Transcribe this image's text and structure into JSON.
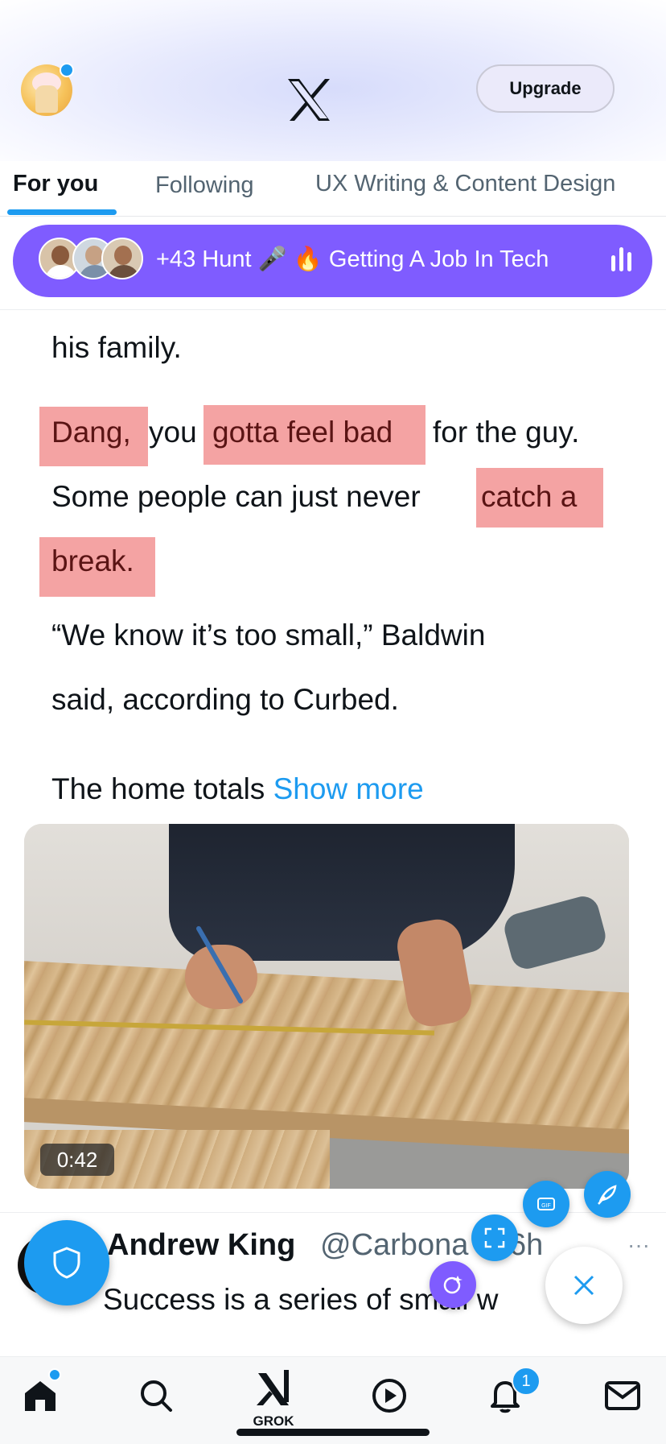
{
  "header": {
    "upgrade_label": "Upgrade"
  },
  "tabs": [
    {
      "label": "For you",
      "active": true
    },
    {
      "label": "Following",
      "active": false
    },
    {
      "label": "UX Writing & Content Design",
      "active": false
    }
  ],
  "space": {
    "text": "+43 Hunt 🎤 🔥 Getting A Job In Tech"
  },
  "article": {
    "line1": "his family.",
    "line2_a": "Dang,",
    "line2_b": "you",
    "line2_c": "gotta feel bad",
    "line2_d": "for the guy.",
    "line3_a": "Some people can just never",
    "line3_b": "catch a",
    "line4": "break.",
    "line5": "“We know it’s too small,” Baldwin",
    "line6": "said, according to Curbed.",
    "line7": "The home totals",
    "show_more": "Show more"
  },
  "media": {
    "duration": "0:42"
  },
  "post": {
    "name": "Andrew King",
    "handle": "@Carbona",
    "time": "• 16h",
    "text": "Success is a series of small w"
  },
  "nav": {
    "grok_label": "GROK",
    "notifications_count": "1"
  },
  "colors": {
    "accent": "#1d9bf0",
    "space": "#7f5cff",
    "highlight": "#f4a3a3"
  }
}
